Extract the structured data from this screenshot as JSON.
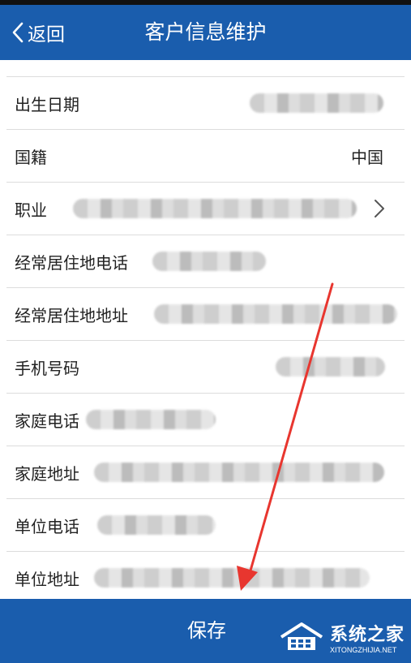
{
  "header": {
    "back_label": "返回",
    "title": "客户信息维护"
  },
  "form": {
    "rows": [
      {
        "label": "出生日期",
        "value": "",
        "blurred": true
      },
      {
        "label": "国籍",
        "value": "中国",
        "blurred": false
      },
      {
        "label": "职业",
        "value": "",
        "blurred": true,
        "has_chevron": true
      },
      {
        "label": "经常居住地电话",
        "value": "",
        "blurred": true
      },
      {
        "label": "经常居住地地址",
        "value": "",
        "blurred": true
      },
      {
        "label": "手机号码",
        "value": "",
        "blurred": true
      },
      {
        "label": "家庭电话",
        "value": "",
        "blurred": true
      },
      {
        "label": "家庭地址",
        "value": "",
        "blurred": true
      },
      {
        "label": "单位电话",
        "value": "",
        "blurred": true
      },
      {
        "label": "单位地址",
        "value": "",
        "blurred": true
      }
    ]
  },
  "footer": {
    "save_label": "保存"
  },
  "watermark": {
    "main": "系统之家",
    "sub": "XITONGZHIJIA.NET"
  },
  "colors": {
    "brand_blue": "#1a5dad",
    "annotation_red": "#e8362f"
  },
  "icons": {
    "back": "chevron-left-icon",
    "row_chevron": "chevron-right-icon",
    "watermark_logo": "house-logo-icon"
  }
}
